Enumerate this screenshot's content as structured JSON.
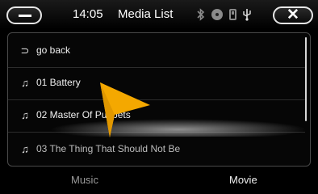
{
  "status_bar": {
    "time": "14:05",
    "title": "Media List",
    "minus_button_label": "—",
    "close_button_label": "✕",
    "icons": [
      "bluetooth-icon",
      "disc-icon",
      "ipod-icon",
      "usb-icon"
    ]
  },
  "list": {
    "items": [
      {
        "icon": "back-arrow-icon",
        "glyph": "⊃",
        "label": "go back"
      },
      {
        "icon": "music-note-icon",
        "glyph": "♫",
        "label": "01 Battery"
      },
      {
        "icon": "music-note-icon",
        "glyph": "♫",
        "label": "02 Master Of Puppets"
      },
      {
        "icon": "music-note-icon",
        "glyph": "♫",
        "label": "03 The Thing That Should Not Be"
      }
    ]
  },
  "tabs": [
    {
      "label": "Music"
    },
    {
      "label": "Movie"
    }
  ],
  "colors": {
    "background": "#000000",
    "text": "#ffffff",
    "cursor": "#f4a800"
  }
}
